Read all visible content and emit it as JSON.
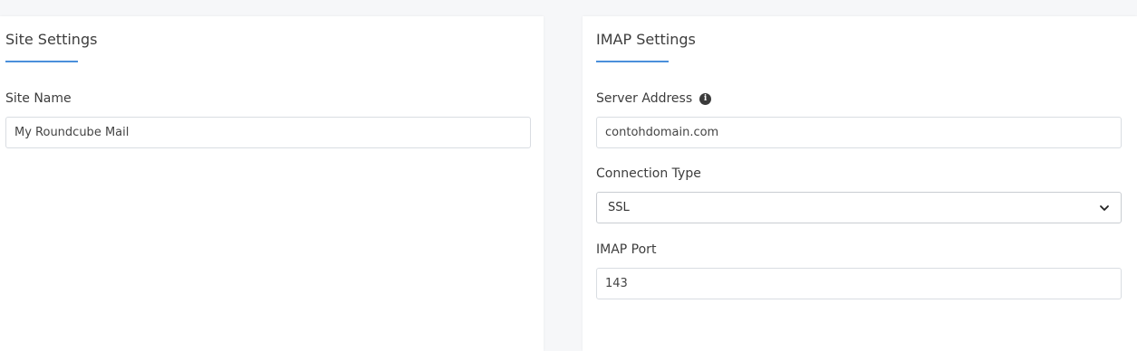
{
  "site_settings": {
    "title": "Site Settings",
    "site_name_label": "Site Name",
    "site_name_value": "My Roundcube Mail"
  },
  "imap_settings": {
    "title": "IMAP Settings",
    "server_address_label": "Server Address",
    "server_address_value": "contohdomain.com",
    "connection_type_label": "Connection Type",
    "connection_type_value": "SSL",
    "imap_port_label": "IMAP Port",
    "imap_port_value": "143"
  },
  "icons": {
    "server_info": "info-icon",
    "select_arrow": "chevron-down-icon"
  },
  "colors": {
    "accent": "#4a8fdb",
    "background": "#f6f7f9",
    "card": "#ffffff"
  }
}
